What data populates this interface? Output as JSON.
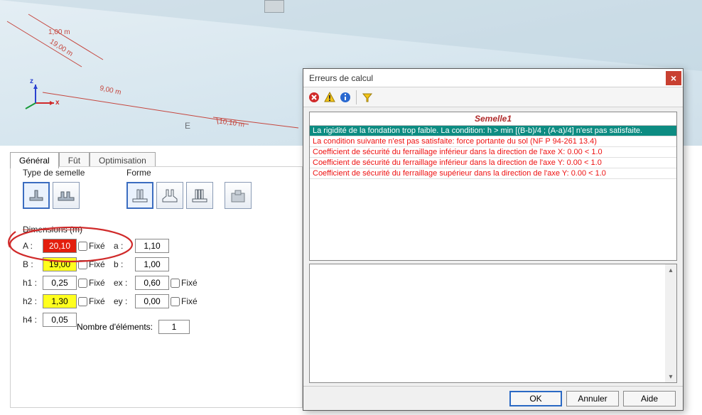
{
  "viewport": {
    "dims": [
      "1,00 m",
      "19,00 m",
      "9,00 m",
      "10,10 m"
    ],
    "axes": {
      "x": "x",
      "z": "z"
    },
    "e_marker": "E"
  },
  "tabs": {
    "general": "Général",
    "fut": "Fût",
    "optimisation": "Optimisation"
  },
  "groups": {
    "type_semelle": "Type de semelle",
    "forme": "Forme",
    "dimensions": "Dimensions (m)"
  },
  "dims": {
    "A_label": "A :",
    "A_value": "20,10",
    "A_fixe": false,
    "B_label": "B :",
    "B_value": "19,00",
    "B_fixe": false,
    "h1_label": "h1 :",
    "h1_value": "0,25",
    "h1_fixe": false,
    "h2_label": "h2 :",
    "h2_value": "1,30",
    "h2_fixe": false,
    "h4_label": "h4 :",
    "h4_value": "0,05",
    "a_label": "a :",
    "a_value": "1,10",
    "b_label": "b :",
    "b_value": "1,00",
    "ex_label": "ex :",
    "ex_value": "0,60",
    "ex_fixe": false,
    "ey_label": "ey :",
    "ey_value": "0,00",
    "ey_fixe": false,
    "fixe_text": "Fixé",
    "nb_label": "Nombre d'éléments:",
    "nb_value": "1"
  },
  "dialog": {
    "title": "Erreurs de calcul",
    "header": "Semelle1",
    "rows": [
      "La rigidité de la fondation trop faible. La condition: h > min [(B-b)/4 ; (A-a)/4] n'est pas satisfaite.",
      "La condition suivante n'est pas satisfaite: force portante du sol (NF P 94-261 13.4)",
      "Coefficient de sécurité du ferraillage inférieur dans la direction de l'axe X: 0.00 < 1.0",
      "Coefficient de sécurité du ferraillage inférieur dans la direction de l'axe Y: 0.00 < 1.0",
      "Coefficient de sécurité du ferraillage supérieur dans la direction de l'axe Y: 0.00 < 1.0"
    ],
    "buttons": {
      "ok": "OK",
      "cancel": "Annuler",
      "help": "Aide"
    }
  }
}
